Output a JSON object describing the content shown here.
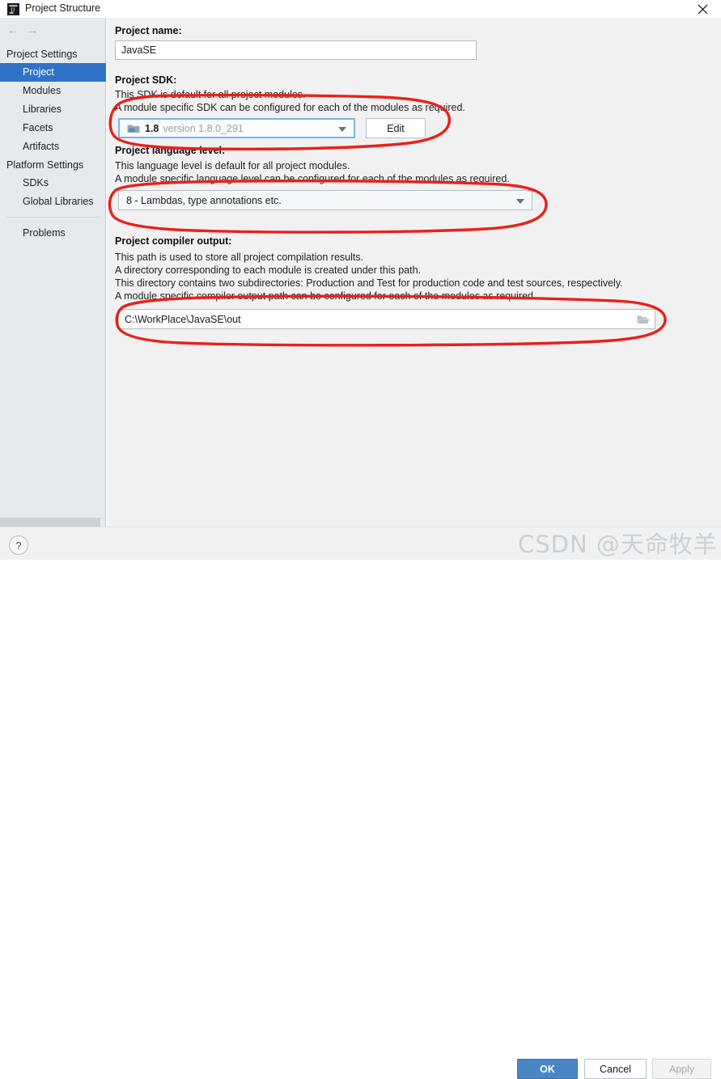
{
  "window": {
    "title": "Project Structure",
    "app_icon": "intellij-idea-icon",
    "close_icon": "close-icon"
  },
  "nav": {
    "back_icon": "arrow-left-icon",
    "forward_icon": "arrow-right-icon"
  },
  "sidebar": {
    "groups": [
      {
        "label": "Project Settings",
        "items": [
          {
            "label": "Project",
            "selected": true
          },
          {
            "label": "Modules",
            "selected": false
          },
          {
            "label": "Libraries",
            "selected": false
          },
          {
            "label": "Facets",
            "selected": false
          },
          {
            "label": "Artifacts",
            "selected": false
          }
        ]
      },
      {
        "label": "Platform Settings",
        "items": [
          {
            "label": "SDKs",
            "selected": false
          },
          {
            "label": "Global Libraries",
            "selected": false
          }
        ]
      }
    ],
    "problems": "Problems"
  },
  "main": {
    "project_name": {
      "label": "Project name:",
      "value": "JavaSE",
      "placeholder": ""
    },
    "project_sdk": {
      "label": "Project SDK:",
      "desc_line1": "This SDK is default for all project modules.",
      "desc_line2": "A module specific SDK can be configured for each of the modules as required.",
      "sdk_icon": "jdk-folder-icon",
      "sdk_version": "1.8",
      "sdk_detail": "version 1.8.0_291",
      "dropdown_icon": "chevron-down-icon",
      "edit_button": "Edit"
    },
    "language_level": {
      "label": "Project language level:",
      "desc_line1": "This language level is default for all project modules.",
      "desc_line2": "A module specific language level can be configured for each of the modules as required.",
      "value": "8 - Lambdas, type annotations etc.",
      "dropdown_icon": "chevron-down-icon"
    },
    "compiler_output": {
      "label": "Project compiler output:",
      "desc_line1": "This path is used to store all project compilation results.",
      "desc_line2": "A directory corresponding to each module is created under this path.",
      "desc_line3": "This directory contains two subdirectories: Production and Test for production code and test sources, respectively.",
      "desc_line4": "A module specific compiler output path can be configured for each of the modules as required.",
      "value": "C:\\WorkPlace\\JavaSE\\out",
      "browse_icon": "folder-open-icon"
    }
  },
  "footer": {
    "help_icon": "?",
    "ok_label": "OK",
    "cancel_label": "Cancel",
    "apply_label": "Apply"
  },
  "watermark": {
    "text": "CSDN @天命牧羊"
  },
  "colors": {
    "accent": "#2f73c8",
    "primary_button": "#4a86c5",
    "sidebar_bg": "#e6eaed",
    "main_bg": "#f1f1f1",
    "annotation": "#e8211b"
  }
}
